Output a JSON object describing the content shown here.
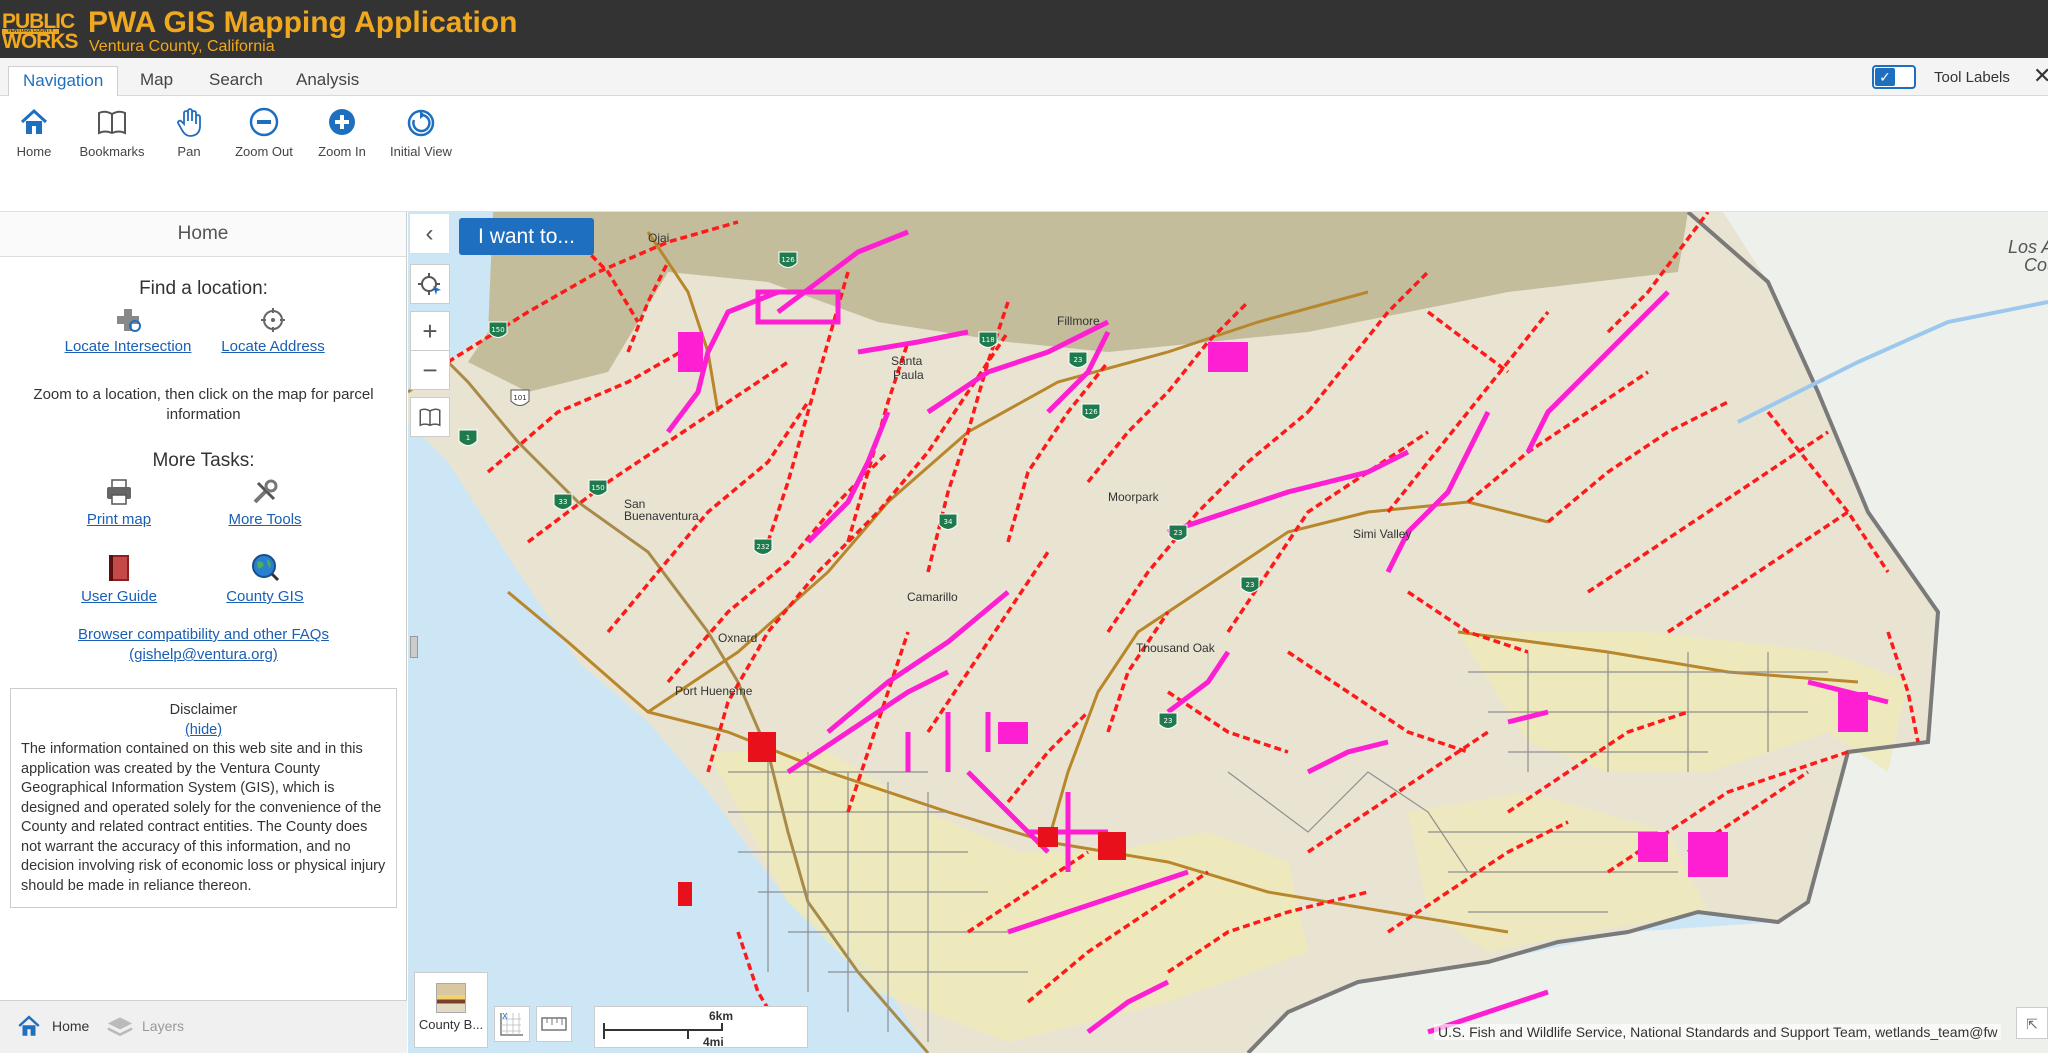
{
  "header": {
    "logo_line1": "PUBLIC",
    "logo_middle": "VENTURA COUNTY",
    "logo_line2": "WORKS",
    "title": "PWA GIS Mapping Application",
    "subtitle": "Ventura County, California"
  },
  "tabs": [
    {
      "label": "Navigation"
    },
    {
      "label": "Map"
    },
    {
      "label": "Search"
    },
    {
      "label": "Analysis"
    }
  ],
  "tool_labels": {
    "label": "Tool Labels",
    "checked": true
  },
  "toolbar": {
    "home": "Home",
    "bookmarks": "Bookmarks",
    "pan": "Pan",
    "zoom_out": "Zoom Out",
    "zoom_in": "Zoom In",
    "initial_view": "Initial View"
  },
  "panel": {
    "title": "Home",
    "find_heading": "Find a location:",
    "locate_intersection": "Locate Intersection",
    "locate_address": "Locate Address",
    "zoom_note": "Zoom to a location, then click on the map for parcel information",
    "more_tasks": "More Tasks:",
    "print_map": "Print map",
    "more_tools": "More Tools",
    "user_guide": "User Guide",
    "county_gis": "County GIS",
    "faq_link": "Browser compatibility and other FAQs",
    "faq_email": "(gishelp@ventura.org)",
    "disclaimer_title": "Disclaimer",
    "disclaimer_hide": "(hide)",
    "disclaimer_text": "The information contained on this web site and in this application was created by the Ventura County Geographical Information System (GIS), which is designed and operated solely for the convenience of the County and related contract entities. The County does not warrant the accuracy of this information, and no decision involving risk of economic loss or physical injury should be made in reliance thereon."
  },
  "bottom_tabs": {
    "home": "Home",
    "layers": "Layers"
  },
  "map": {
    "i_want_to": "I want to...",
    "basemap_label": "County B...",
    "scale_km": "6km",
    "scale_mi": "4mi",
    "attribution": "U.S. Fish and Wildlife Service, National Standards and Support Team, wetlands_team@fw",
    "places": {
      "fillmore": "Fillmore",
      "santa": "Santa",
      "paula": "Paula",
      "moorpark": "Moorpark",
      "simi_valley": "Simi Valley",
      "san": "San",
      "buenaventura": "Buenaventura",
      "camarillo": "Camarillo",
      "oxnard": "Oxnard",
      "thousand_oaks": "Thousand Oak",
      "port_hueneme": "Port Hueneme",
      "los_angeles": "Los Ang",
      "county": "Coun",
      "ojai": "Ojai"
    },
    "shields": [
      "150",
      "101",
      "126",
      "23",
      "118",
      "34",
      "1",
      "33",
      "232",
      "150",
      "126",
      "23",
      "23",
      "23"
    ]
  },
  "colors": {
    "accent": "#1f6fc0",
    "header_bg": "#333333",
    "logo_gold": "#f0a91e",
    "drainage_red": "#ff1a1a",
    "facility_magenta": "#ff1fd2",
    "ocean": "#cde6f5"
  }
}
